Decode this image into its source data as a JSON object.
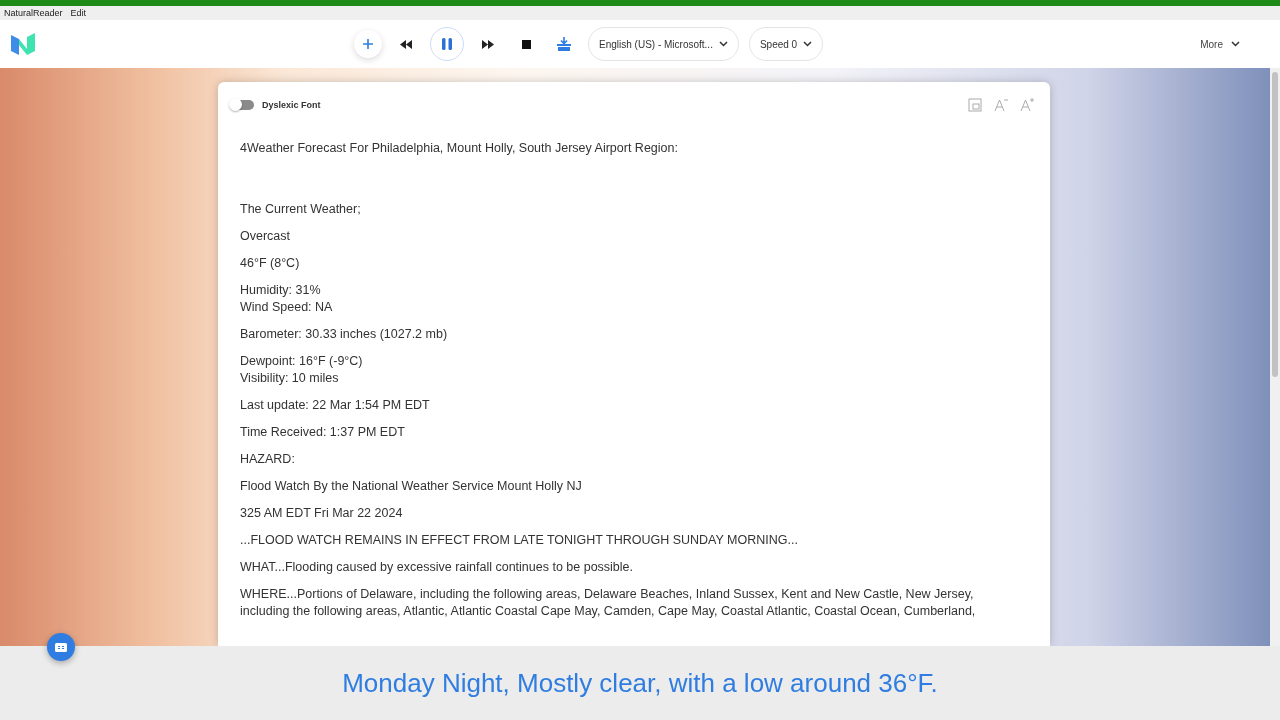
{
  "menu": [
    "NaturalReader",
    "Edit"
  ],
  "toolbar": {
    "playing": true,
    "voice": "English (US) - Microsoft...",
    "speed": "Speed 0",
    "more": "More"
  },
  "document": {
    "dyslexic_font": {
      "label": "Dyslexic Font",
      "on": false
    },
    "paragraphs": [
      {
        "kind": "heading",
        "lines": [
          "4Weather Forecast For Philadelphia, Mount Holly, South Jersey Airport Region:"
        ]
      },
      {
        "kind": "text",
        "lines": [
          "The Current Weather;"
        ]
      },
      {
        "kind": "text",
        "lines": [
          "Overcast"
        ]
      },
      {
        "kind": "text",
        "lines": [
          "46°F (8°C)"
        ]
      },
      {
        "kind": "text",
        "lines": [
          "Humidity: 31%",
          "Wind Speed: NA"
        ]
      },
      {
        "kind": "text",
        "lines": [
          "Barometer: 30.33 inches (1027.2 mb)"
        ]
      },
      {
        "kind": "text",
        "lines": [
          "Dewpoint: 16°F (-9°C)",
          "Visibility: 10 miles"
        ]
      },
      {
        "kind": "text",
        "lines": [
          "Last update: 22 Mar 1:54 PM EDT"
        ]
      },
      {
        "kind": "text",
        "lines": [
          "Time Received: 1:37 PM EDT"
        ]
      },
      {
        "kind": "text",
        "lines": [
          "HAZARD:"
        ]
      },
      {
        "kind": "text",
        "lines": [
          "Flood Watch By the National Weather Service Mount Holly NJ"
        ]
      },
      {
        "kind": "text",
        "lines": [
          "325 AM EDT Fri Mar 22 2024"
        ]
      },
      {
        "kind": "text",
        "lines": [
          "...FLOOD WATCH REMAINS IN EFFECT FROM LATE TONIGHT THROUGH SUNDAY MORNING..."
        ]
      },
      {
        "kind": "text",
        "lines": [
          "WHAT...Flooding caused by excessive rainfall continues to be possible."
        ]
      },
      {
        "kind": "text",
        "lines": [
          "WHERE...Portions of Delaware, including the following areas, Delaware Beaches, Inland Sussex, Kent and New Castle, New Jersey,",
          "including the following areas, Atlantic, Atlantic Coastal Cape May, Camden, Cape May, Coastal Atlantic, Coastal Ocean, Cumberland,"
        ]
      }
    ]
  },
  "caption": "Monday Night, Mostly clear, with a low around 36°F."
}
